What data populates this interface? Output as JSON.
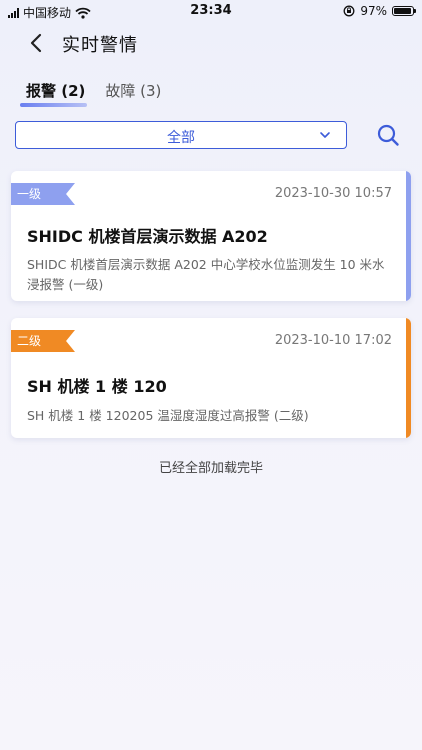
{
  "status": {
    "carrier": "中国移动",
    "time": "23:34",
    "battery": "97%",
    "battery_level": 0.97
  },
  "nav": {
    "title": "实时警情"
  },
  "tabs": [
    {
      "label": "报警 (2)",
      "active": true
    },
    {
      "label": "故障 (3)",
      "active": false
    }
  ],
  "filter": {
    "selected": "全部"
  },
  "alarms": [
    {
      "level": "一级",
      "time": "2023-10-30 10:57",
      "title": "SHIDC 机楼首层演示数据 A202",
      "description": "SHIDC 机楼首层演示数据 A202 中心学校水位监测发生 10 米水浸报警 (一级)",
      "color": "#8ea0ef"
    },
    {
      "level": "二级",
      "time": "2023-10-10 17:02",
      "title": "SH 机楼 1 楼 120",
      "description": "SH 机楼 1 楼 120205 温湿度湿度过高报警 (二级)",
      "color": "#f08a24"
    }
  ],
  "footer": {
    "text": "已经全部加载完毕"
  },
  "colors": {
    "primary": "#3d5cd9",
    "level1": "#8ea0ef",
    "level2": "#f08a24"
  }
}
